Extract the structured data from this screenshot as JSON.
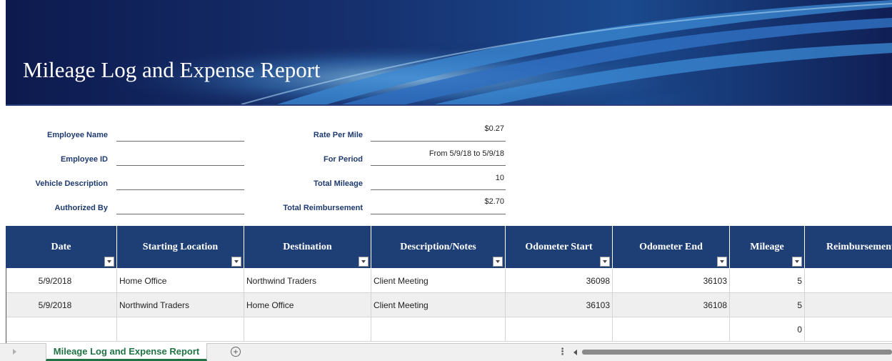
{
  "banner": {
    "title": "Mileage Log and Expense Report"
  },
  "fields_left": [
    {
      "label": "Employee Name",
      "value": ""
    },
    {
      "label": "Employee ID",
      "value": ""
    },
    {
      "label": "Vehicle Description",
      "value": ""
    },
    {
      "label": "Authorized By",
      "value": ""
    }
  ],
  "fields_right": [
    {
      "label": "Rate Per Mile",
      "value": "$0.27"
    },
    {
      "label": "For Period",
      "value": "From 5/9/18 to 5/9/18"
    },
    {
      "label": "Total Mileage",
      "value": "10"
    },
    {
      "label": "Total Reimbursement",
      "value": "$2.70"
    }
  ],
  "table": {
    "headers": [
      "Date",
      "Starting Location",
      "Destination",
      "Description/Notes",
      "Odometer Start",
      "Odometer End",
      "Mileage",
      "Reimbursement"
    ],
    "rows": [
      [
        "5/9/2018",
        "Home Office",
        "Northwind Traders",
        "Client Meeting",
        "36098",
        "36103",
        "5",
        ""
      ],
      [
        "5/9/2018",
        "Northwind Traders",
        "Home Office",
        "Client Meeting",
        "36103",
        "36108",
        "5",
        ""
      ],
      [
        "",
        "",
        "",
        "",
        "",
        "",
        "0",
        ""
      ]
    ]
  },
  "sheet_tabs": {
    "active": "Mileage Log and Expense Report",
    "add_label": "+"
  },
  "colors": {
    "header_bg": "#1e3f76",
    "label_text": "#1f3a6e",
    "active_tab": "#217346"
  }
}
